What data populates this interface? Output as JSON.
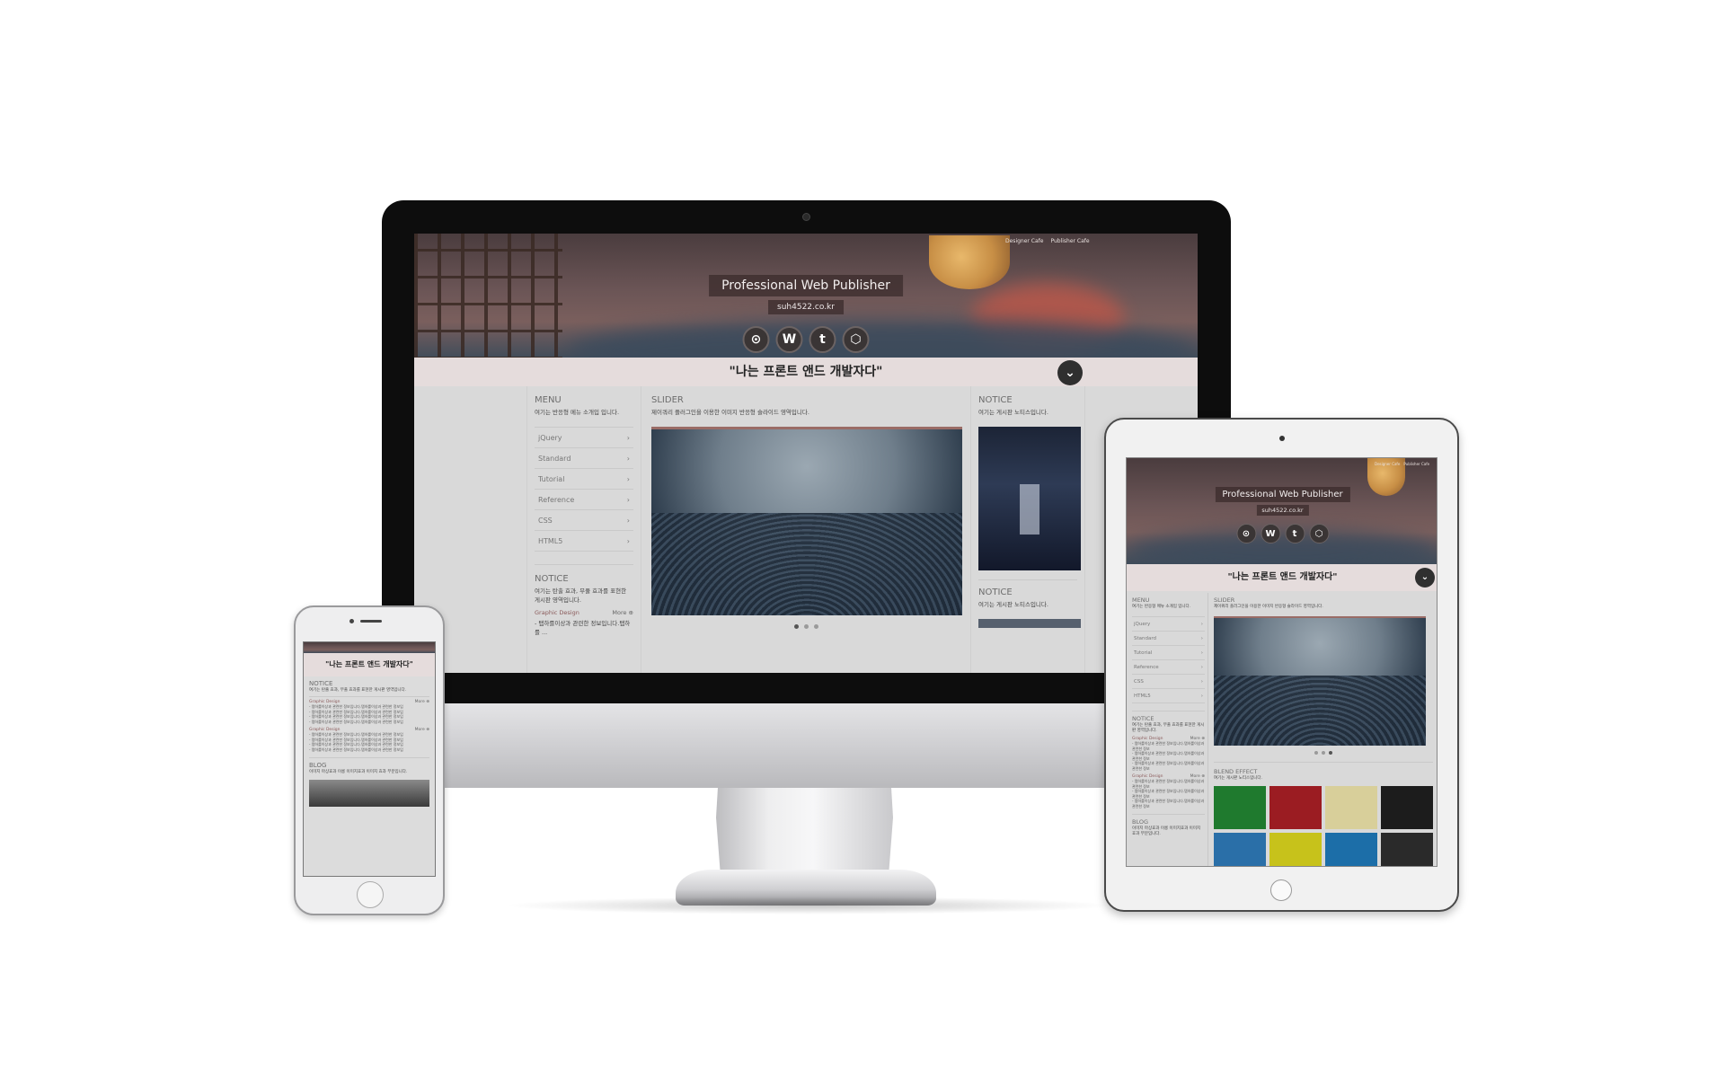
{
  "site": {
    "top_links": [
      "Designer Cafe",
      "Publisher Cafe"
    ],
    "title": "Professional Web Publisher",
    "domain": "suh4522.co.kr",
    "social_icons": [
      {
        "name": "github-icon",
        "glyph": "⊙"
      },
      {
        "name": "wordpress-icon",
        "glyph": "W"
      },
      {
        "name": "tumblr-icon",
        "glyph": "t"
      },
      {
        "name": "codepen-icon",
        "glyph": "⬡"
      }
    ],
    "quote": "\"나는 프론트 앤드 개발자다\"",
    "chevron_glyph": "⌄"
  },
  "menu": {
    "label": "MENU",
    "desc": "여기는 반응형 메뉴 소개입 입니다.",
    "items": [
      "jQuery",
      "Standard",
      "Tutorial",
      "Reference",
      "CSS",
      "HTML5"
    ],
    "arrow": "›"
  },
  "slider": {
    "label": "SLIDER",
    "desc": "제이쿼리 플러그인을 이용한 이미지 반응형 슬라이드 영역입니다.",
    "dot_count": 3,
    "active_dot": 0
  },
  "notice": {
    "label": "NOTICE",
    "desc": "여기는 게시판 노티스입니다.",
    "desc_long": "여기는 탄출 효과, 무풀 효과를 표현한 게시판 영역입니다."
  },
  "blog_post": {
    "category": "Graphic Design",
    "more": "More ⊕",
    "line": "- 탭하를이상과 관련한 정보입니다.탭하를 ..."
  },
  "tablet": {
    "blend_label": "BLEND EFFECT",
    "blend_desc": "여기는 게시판 노티스입니다.",
    "blog_label": "BLOG",
    "blog_desc": "이미지 마상효과 이롱 이미지효과 이미지 효과 부분입니다.",
    "tiny_lines": [
      "- 탭하를이상과 관련한 정보입니다.탭하를이상과 관련한 정보",
      "- 탭하를이상과 관련한 정보입니다.탭하를이상과 관련한 정보",
      "- 탭하를이상과 관련한 정보입니다.탭하를이상과 관련한 정보"
    ],
    "blend_colors": [
      "#1f7a2e",
      "#9b1c22",
      "#d8cf9a",
      "#1c1c1c",
      "#2a6fa8",
      "#c7c21b",
      "#1c6ea8",
      "#2a2a2a"
    ]
  },
  "phone": {
    "notice_label": "NOTICE",
    "notice_desc": "여기는 탄출 효과, 무풀 효과를 표현한 게시판 영역입니다.",
    "blog_label": "BLOG",
    "blog_desc": "이미지 마상효과 이롱 이미지효과 이미지 효과 부분입니다.",
    "lines": [
      "- 탭하를이상과 관련한 정보입니다.탭하를이상과 관련한 정보입",
      "- 탭하를이상과 관련한 정보입니다.탭하를이상과 관련한 정보입",
      "- 탭하를이상과 관련한 정보입니다.탭하를이상과 관련한 정보입",
      "- 탭하를이상과 관련한 정보입니다.탭하를이상과 관련한 정보입"
    ]
  },
  "colors": {
    "quote_bg": "#e5dcdc",
    "body_bg": "#d9d9d9",
    "header_sky": "#6b5556"
  }
}
